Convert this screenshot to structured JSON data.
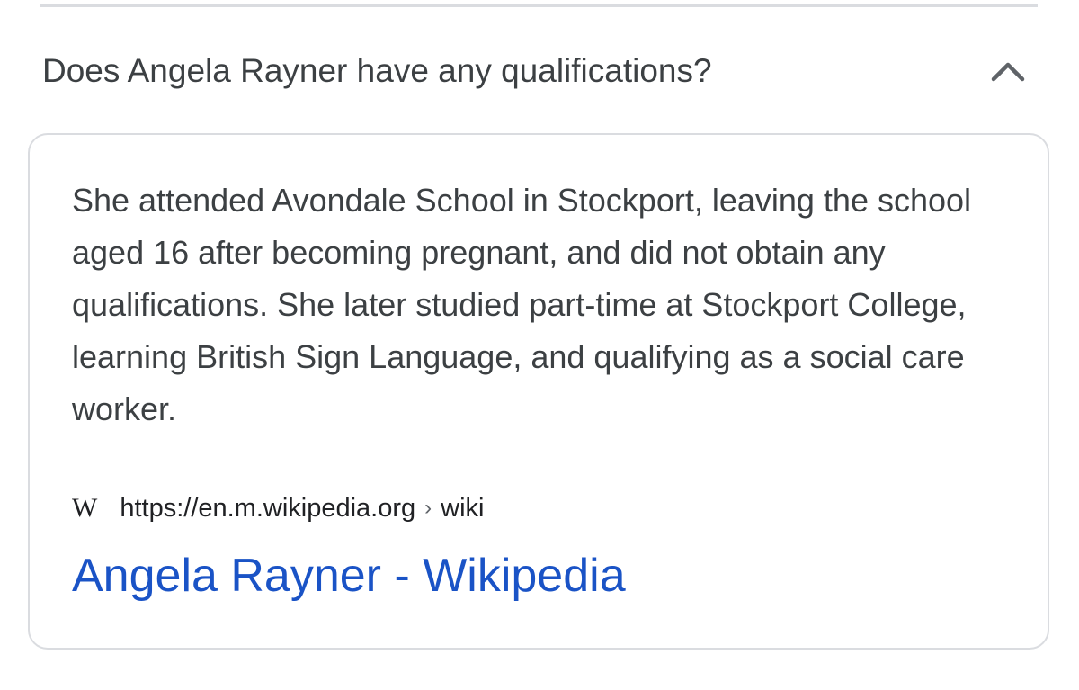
{
  "accordion": {
    "question": "Does Angela Rayner have any qualifications?",
    "toggle_icon": "chevron-up-icon",
    "expanded": true
  },
  "answer": {
    "text": "She attended Avondale School in Stockport, leaving the school aged 16 after becoming pregnant, and did not obtain any qualifications. She later studied part-time at Stockport College, learning British Sign Language, and qualifying as a social care worker.",
    "source": {
      "favicon_text": "W",
      "favicon_icon": "wikipedia-icon",
      "url": "https://en.m.wikipedia.org",
      "separator": "›",
      "path": "wiki"
    },
    "link_title": "Angela Rayner - Wikipedia"
  },
  "colors": {
    "text": "#3c4043",
    "link": "#1a53c6",
    "divider": "#dadce0"
  }
}
